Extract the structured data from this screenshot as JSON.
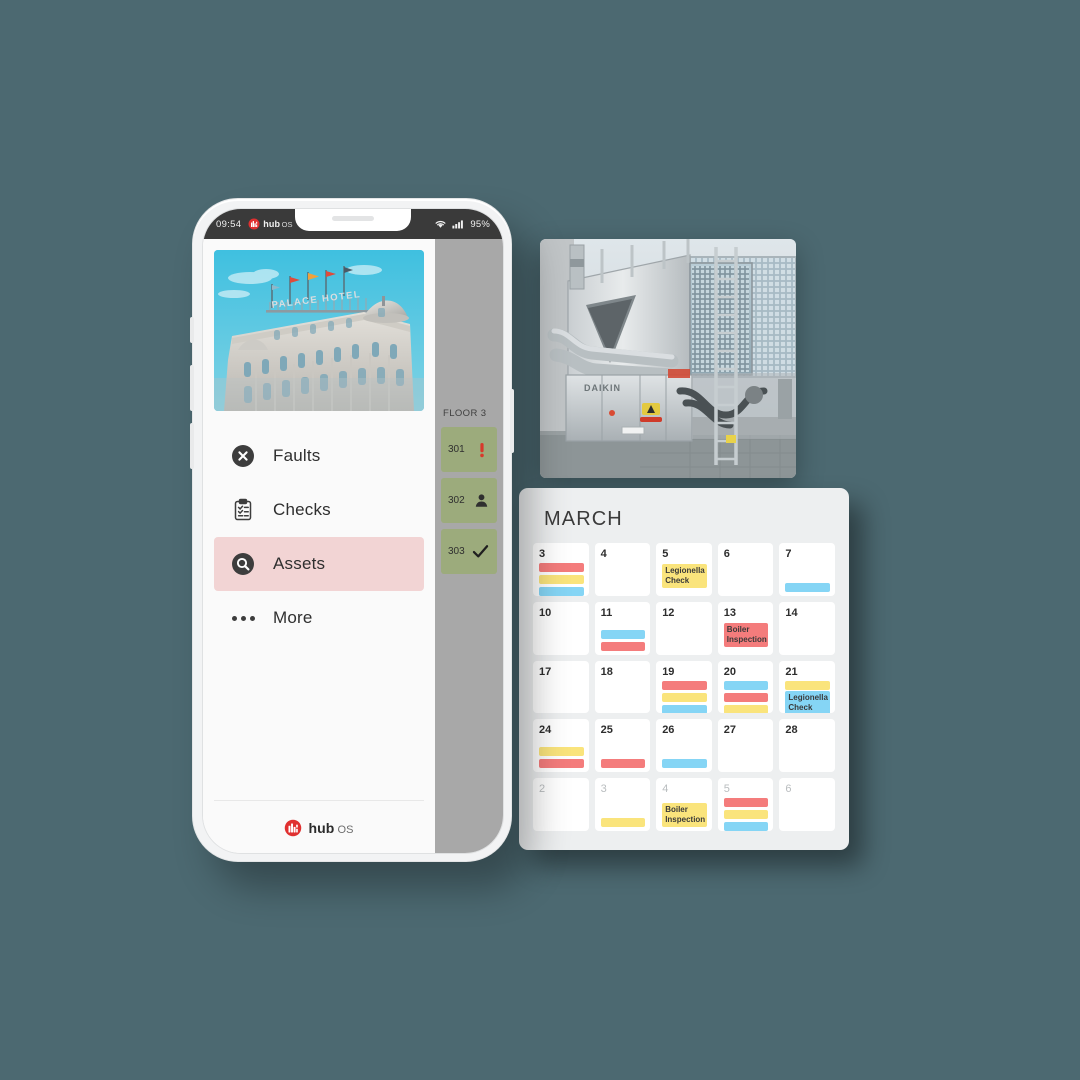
{
  "background_color": "#4c6971",
  "phone": {
    "status_bar": {
      "time": "09:54",
      "brand": "hub",
      "brand_suffix": "OS",
      "wifi_icon": "wifi-icon",
      "signal_icon": "signal-bars-icon",
      "battery": "95%"
    },
    "hero_image": {
      "name": "hotel-exterior-photo",
      "alt": "PALACE HOTEL building with flags",
      "sign_text": "PALACE HOTEL"
    },
    "menu": {
      "items": [
        {
          "label": "Faults",
          "icon": "x-circle-icon",
          "active": false
        },
        {
          "label": "Checks",
          "icon": "clipboard-check-icon",
          "active": false
        },
        {
          "label": "Assets",
          "icon": "magnifier-circle-icon",
          "active": true
        },
        {
          "label": "More",
          "icon": "ellipsis-icon",
          "active": false
        }
      ],
      "active_highlight_color": "#f2d4d4"
    },
    "footer": {
      "brand": "hub",
      "brand_suffix": "OS"
    },
    "floor_panel": {
      "title": "FLOOR 3",
      "card_color": "#9cab7c",
      "rooms": [
        {
          "number": "301",
          "status_icon": "alert-exclamation-icon",
          "status_color": "#d8392b"
        },
        {
          "number": "302",
          "status_icon": "person-icon",
          "status_color": "#2f2f2f"
        },
        {
          "number": "303",
          "status_icon": "checkmark-icon",
          "status_color": "#1f1f1f"
        }
      ]
    }
  },
  "hvac_photo": {
    "name": "chiller-unit-photo",
    "alt": "DAIKIN industrial chiller HVAC unit outdoors",
    "label": "DAIKIN"
  },
  "calendar": {
    "title": "MARCH",
    "colors": {
      "red": "#f47c7c",
      "yellow": "#fae47c",
      "blue": "#85d5f5",
      "panel": "#edeff0"
    },
    "weeks": [
      [
        {
          "day": "3",
          "muted": false,
          "bars": [
            "red",
            "yellow",
            "blue"
          ],
          "events": []
        },
        {
          "day": "4",
          "muted": false,
          "bars": [],
          "events": []
        },
        {
          "day": "5",
          "muted": false,
          "bars": [],
          "events": [
            {
              "text": "Legionella Check",
              "color": "yellow"
            }
          ]
        },
        {
          "day": "6",
          "muted": false,
          "bars": [],
          "events": []
        },
        {
          "day": "7",
          "muted": false,
          "bars": [
            "blue"
          ],
          "events": [],
          "bars_bottom": true
        }
      ],
      [
        {
          "day": "10",
          "muted": false,
          "bars": [],
          "events": []
        },
        {
          "day": "11",
          "muted": false,
          "bars": [
            "blue",
            "red"
          ],
          "events": [],
          "bars_bottom": true
        },
        {
          "day": "12",
          "muted": false,
          "bars": [],
          "events": []
        },
        {
          "day": "13",
          "muted": false,
          "bars": [],
          "events": [
            {
              "text": "Boiler Inspection",
              "color": "red"
            }
          ]
        },
        {
          "day": "14",
          "muted": false,
          "bars": [],
          "events": []
        }
      ],
      [
        {
          "day": "17",
          "muted": false,
          "bars": [],
          "events": []
        },
        {
          "day": "18",
          "muted": false,
          "bars": [],
          "events": []
        },
        {
          "day": "19",
          "muted": false,
          "bars": [
            "red",
            "yellow",
            "blue"
          ],
          "events": []
        },
        {
          "day": "20",
          "muted": false,
          "bars": [
            "blue",
            "red",
            "yellow"
          ],
          "events": []
        },
        {
          "day": "21",
          "muted": false,
          "bars": [
            "yellow"
          ],
          "events": [
            {
              "text": "Legionella Check",
              "color": "blue"
            }
          ]
        }
      ],
      [
        {
          "day": "24",
          "muted": false,
          "bars": [
            "yellow",
            "red"
          ],
          "events": [],
          "bars_bottom": true
        },
        {
          "day": "25",
          "muted": false,
          "bars": [
            "red"
          ],
          "events": [],
          "bars_bottom": true
        },
        {
          "day": "26",
          "muted": false,
          "bars": [
            "blue"
          ],
          "events": [],
          "bars_bottom": true
        },
        {
          "day": "27",
          "muted": false,
          "bars": [],
          "events": []
        },
        {
          "day": "28",
          "muted": false,
          "bars": [],
          "events": []
        }
      ],
      [
        {
          "day": "2",
          "muted": true,
          "bars": [],
          "events": []
        },
        {
          "day": "3",
          "muted": true,
          "bars": [
            "yellow"
          ],
          "events": [],
          "bars_bottom": true
        },
        {
          "day": "4",
          "muted": true,
          "bars": [],
          "events": [
            {
              "text": "Boiler Inspection",
              "color": "yellow"
            }
          ],
          "bars_bottom": true
        },
        {
          "day": "5",
          "muted": true,
          "bars": [
            "red",
            "yellow",
            "blue"
          ],
          "events": []
        },
        {
          "day": "6",
          "muted": true,
          "bars": [],
          "events": []
        }
      ]
    ]
  }
}
